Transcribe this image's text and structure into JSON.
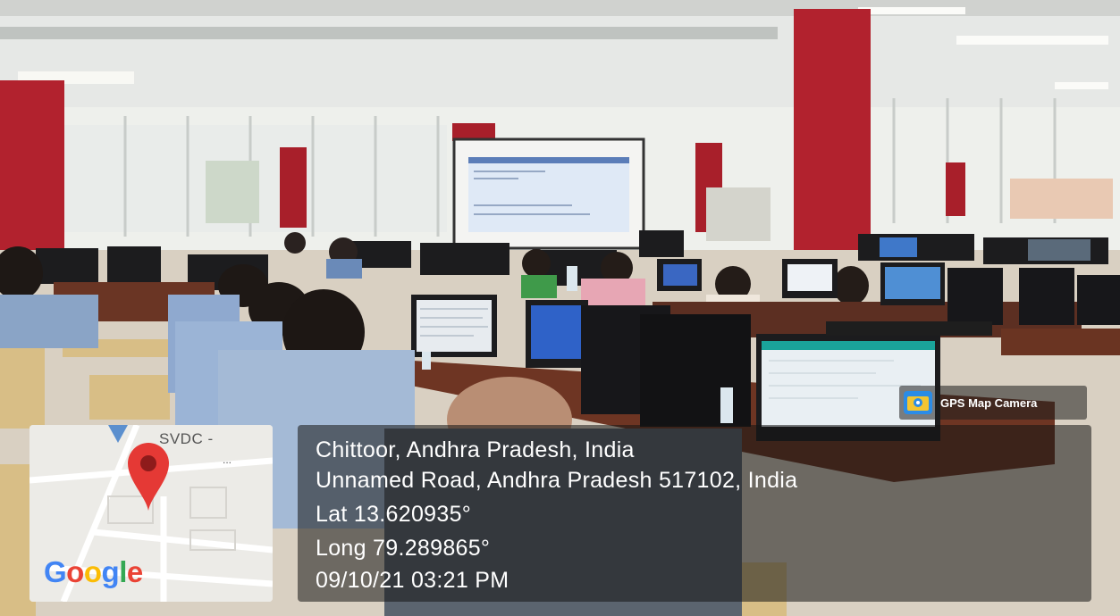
{
  "badge": {
    "label": "GPS Map Camera",
    "icon": "gps-map-camera-logo"
  },
  "map": {
    "place_label": "SVDC -",
    "ellipsis": "...",
    "brand": "Google",
    "pin_color": "#e53935"
  },
  "location": {
    "city_line": "Chittoor, Andhra Pradesh, India",
    "address_line": "Unnamed Road, Andhra Pradesh 517102, India",
    "lat": "Lat 13.620935°",
    "long": "Long 79.289865°",
    "datetime": "09/10/21 03:21 PM"
  },
  "colors": {
    "pillar": "#b2222e",
    "overlay_bg": "#262626",
    "overlay_text": "#ffffff"
  }
}
